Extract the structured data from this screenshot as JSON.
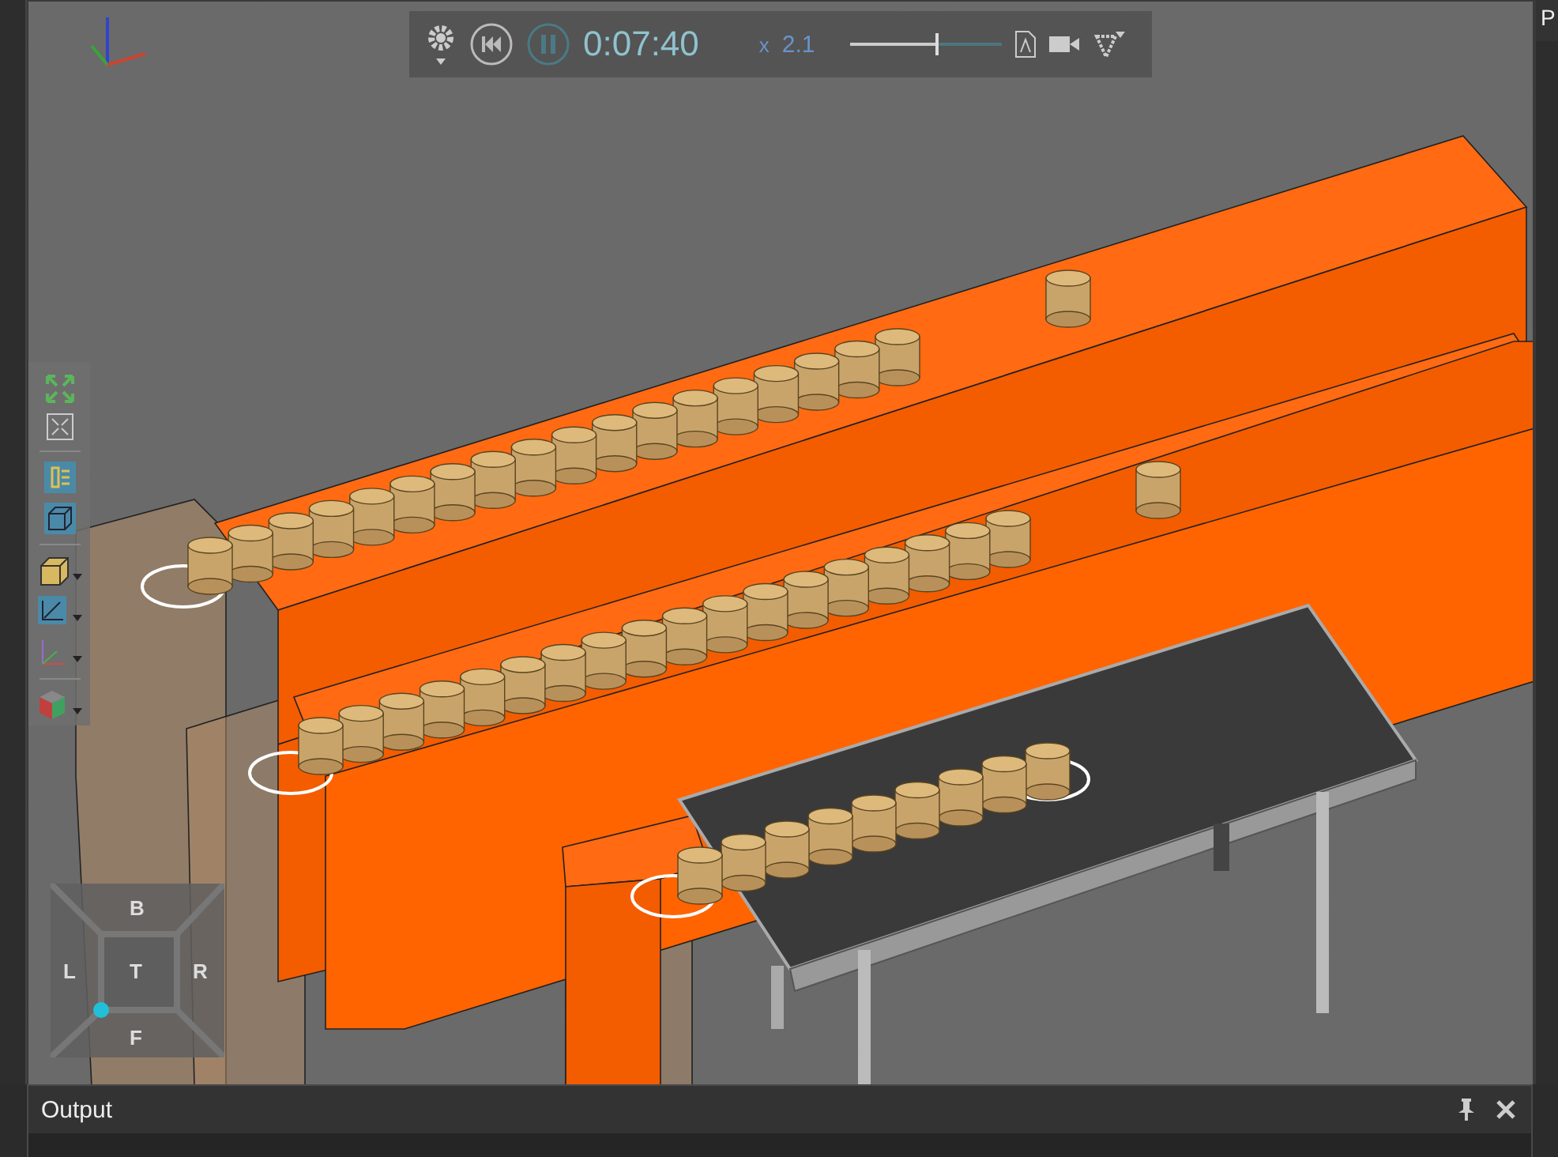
{
  "playback_bar": {
    "playing": true,
    "time": "0:07:40",
    "speed_prefix": "x",
    "speed": "2.1",
    "speed_slider": {
      "level": 0.56
    }
  },
  "view_cube": {
    "top": "B",
    "left": "L",
    "center": "T",
    "right": "R",
    "bottom": "F"
  },
  "output_panel": {
    "title": "Output"
  },
  "right_panel": {
    "title": "P"
  }
}
